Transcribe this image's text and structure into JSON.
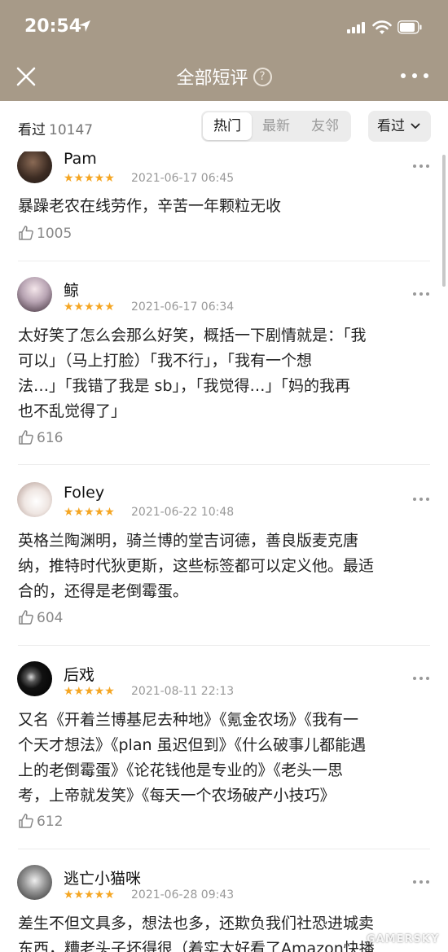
{
  "status": {
    "time": "20:54"
  },
  "nav": {
    "title": "全部短评",
    "help": "?"
  },
  "filter": {
    "seen_label": "看过",
    "seen_count": "10147",
    "tabs": [
      "热门",
      "最新",
      "友邻"
    ],
    "active_tab": "热门",
    "dropdown_label": "看过"
  },
  "colors": {
    "header_bg": "#a79a88",
    "star": "#f5a623"
  },
  "comments": [
    {
      "user": "Pam",
      "stars": "★★★★★",
      "date": "2021-06-17 06:45",
      "text": "暴躁老农在线劳作，辛苦一年颗粒无收",
      "likes": "1005"
    },
    {
      "user": "鲸",
      "stars": "★★★★★",
      "date": "2021-06-17 06:34",
      "text": [
        "太好笑了怎么会那么好笑，概括一下剧情就是：「我",
        "可以」（马上打脸）「我不行」，「我有一个想",
        "法…」「我错了我是 sb」，「我觉得…」「妈的我再",
        "也不乱觉得了」"
      ],
      "likes": "616"
    },
    {
      "user": "Foley",
      "stars": "★★★★★",
      "date": "2021-06-22 10:48",
      "text": [
        "英格兰陶渊明，骑兰博的堂吉诃德，善良版麦克唐",
        "纳，推特时代狄更斯，这些标签都可以定义他。最适",
        "合的，还得是老倒霉蛋。"
      ],
      "likes": "604"
    },
    {
      "user": "后戏",
      "stars": "★★★★★",
      "date": "2021-08-11 22:13",
      "text": [
        "又名《开着兰博基尼去种地》《氪金农场》《我有一",
        "个天才想法》《plan 虽迟但到》《什么破事儿都能遇",
        "上的老倒霉蛋》《论花钱他是专业的》《老头一思",
        "考，上帝就发笑》《每天一个农场破产小技巧》"
      ],
      "likes": "612"
    },
    {
      "user": "逃亡小猫咪",
      "stars": "★★★★★",
      "date": "2021-06-28 09:43",
      "text": [
        "差生不但文具多，想法也多，还欺负我们社恐进城卖",
        "东西，糟老头子坏得很（着实太好看了Amazon快播"
      ],
      "likes": ""
    }
  ],
  "watermark": "GAMERSKY"
}
